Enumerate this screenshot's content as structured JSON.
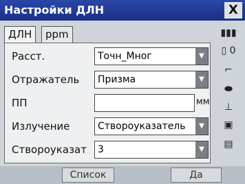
{
  "window": {
    "title": "Настройки ДЛН",
    "close_label": "X"
  },
  "tabs": [
    {
      "label": "ДЛН",
      "active": true
    },
    {
      "label": "ppm",
      "active": false
    }
  ],
  "form": {
    "distance_label": "Расст.",
    "distance_value": "Точн_Мног",
    "reflector_label": "Отражатель",
    "reflector_value": "Призма",
    "pp_label": "ПП",
    "pp_value": "",
    "pp_unit": "мм",
    "emission_label": "Излучение",
    "emission_value": "Створоуказатель",
    "guide_label": "Створоуказат",
    "guide_value": "3"
  },
  "side_icons": [
    "battery-icon",
    "compensator-icon",
    "level-icon",
    "tilt-icon",
    "target-icon",
    "mode-icon"
  ],
  "side_text": {
    "zero": "0"
  },
  "softkeys": {
    "list_label": "Список",
    "ok_label": "Да"
  }
}
